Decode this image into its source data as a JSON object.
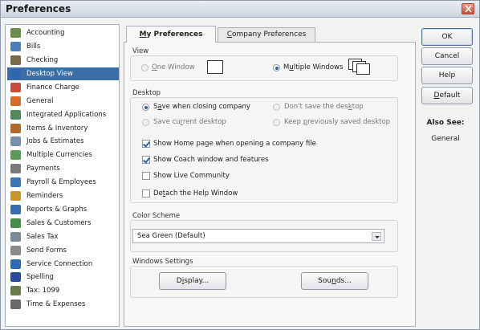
{
  "window": {
    "title": "Preferences"
  },
  "sidebar": {
    "items": [
      {
        "label": "Accounting",
        "icon": "accounting-icon",
        "color": "#6b8e4e"
      },
      {
        "label": "Bills",
        "icon": "bills-icon",
        "color": "#4f7fb8"
      },
      {
        "label": "Checking",
        "icon": "checking-icon",
        "color": "#7a6a4a"
      },
      {
        "label": "Desktop View",
        "icon": "desktop-view-icon",
        "color": "#2f66b0",
        "selected": true
      },
      {
        "label": "Finance Charge",
        "icon": "finance-charge-icon",
        "color": "#c84a3a"
      },
      {
        "label": "General",
        "icon": "general-icon",
        "color": "#d86a2a"
      },
      {
        "label": "Integrated Applications",
        "icon": "integrated-applications-icon",
        "color": "#4f8a58"
      },
      {
        "label": "Items & Inventory",
        "icon": "items-inventory-icon",
        "color": "#b06a2a"
      },
      {
        "label": "Jobs & Estimates",
        "icon": "jobs-estimates-icon",
        "color": "#7a8fae"
      },
      {
        "label": "Multiple Currencies",
        "icon": "multiple-currencies-icon",
        "color": "#5a9a5a"
      },
      {
        "label": "Payments",
        "icon": "payments-icon",
        "color": "#7a7a7a"
      },
      {
        "label": "Payroll & Employees",
        "icon": "payroll-employees-icon",
        "color": "#3a78b8"
      },
      {
        "label": "Reminders",
        "icon": "reminders-icon",
        "color": "#c8962a"
      },
      {
        "label": "Reports & Graphs",
        "icon": "reports-graphs-icon",
        "color": "#3a6ab0"
      },
      {
        "label": "Sales & Customers",
        "icon": "sales-customers-icon",
        "color": "#4a8a4a"
      },
      {
        "label": "Sales Tax",
        "icon": "sales-tax-icon",
        "color": "#7a8a9a"
      },
      {
        "label": "Send Forms",
        "icon": "send-forms-icon",
        "color": "#8a8a8a"
      },
      {
        "label": "Service Connection",
        "icon": "service-connection-icon",
        "color": "#2f6ab0"
      },
      {
        "label": "Spelling",
        "icon": "spelling-icon",
        "color": "#2a4a9a"
      },
      {
        "label": "Tax: 1099",
        "icon": "tax-1099-icon",
        "color": "#6a7a4a"
      },
      {
        "label": "Time & Expenses",
        "icon": "time-expenses-icon",
        "color": "#6a6a6a"
      }
    ]
  },
  "tabs": {
    "my_prefs": {
      "hotkey": "M",
      "rest": "y Preferences"
    },
    "company_prefs": {
      "hotkey": "C",
      "rest": "ompany Preferences"
    }
  },
  "view": {
    "label": "View",
    "one_window": {
      "hotkey": "O",
      "rest": "ne Window",
      "selected": false
    },
    "multiple_windows": {
      "pre": "M",
      "hotkey": "u",
      "rest": "ltiple Windows",
      "selected": true
    }
  },
  "desktop": {
    "label": "Desktop",
    "save_when_closing": {
      "pre": "S",
      "hotkey": "a",
      "rest": "ve when closing company",
      "selected": true
    },
    "dont_save": {
      "pre": "Don't save the des",
      "hotkey": "k",
      "rest": "top",
      "selected": false
    },
    "save_current": {
      "pre": "Save cu",
      "hotkey": "r",
      "rest": "rent desktop",
      "selected": false
    },
    "keep_previous": {
      "pre": "Keep ",
      "hotkey": "p",
      "rest": "reviously saved desktop",
      "selected": false
    },
    "show_home": {
      "label": "Show Home page when opening a company file",
      "checked": true
    },
    "show_coach": {
      "label": "Show Coach window and features",
      "checked": true
    },
    "show_live_community": {
      "label": "Show Live Community",
      "checked": false
    },
    "detach_help": {
      "pre": "De",
      "hotkey": "t",
      "rest": "ach the Help Window",
      "checked": false
    }
  },
  "color_scheme": {
    "label": "Color Scheme",
    "value": "Sea Green (Default)"
  },
  "windows_settings": {
    "label": "Windows Settings",
    "display_button": {
      "pre": "D",
      "hotkey": "i",
      "rest": "splay..."
    },
    "sounds_button": {
      "pre": "Sou",
      "hotkey": "n",
      "rest": "ds..."
    }
  },
  "buttons": {
    "ok": "OK",
    "cancel": "Cancel",
    "help": "Help",
    "default": {
      "hotkey": "D",
      "rest": "efault"
    }
  },
  "also_see": {
    "heading": "Also See:",
    "link": "General"
  },
  "colors": {
    "selection": "#3a6ea5",
    "accent": "#2a5fa0"
  }
}
